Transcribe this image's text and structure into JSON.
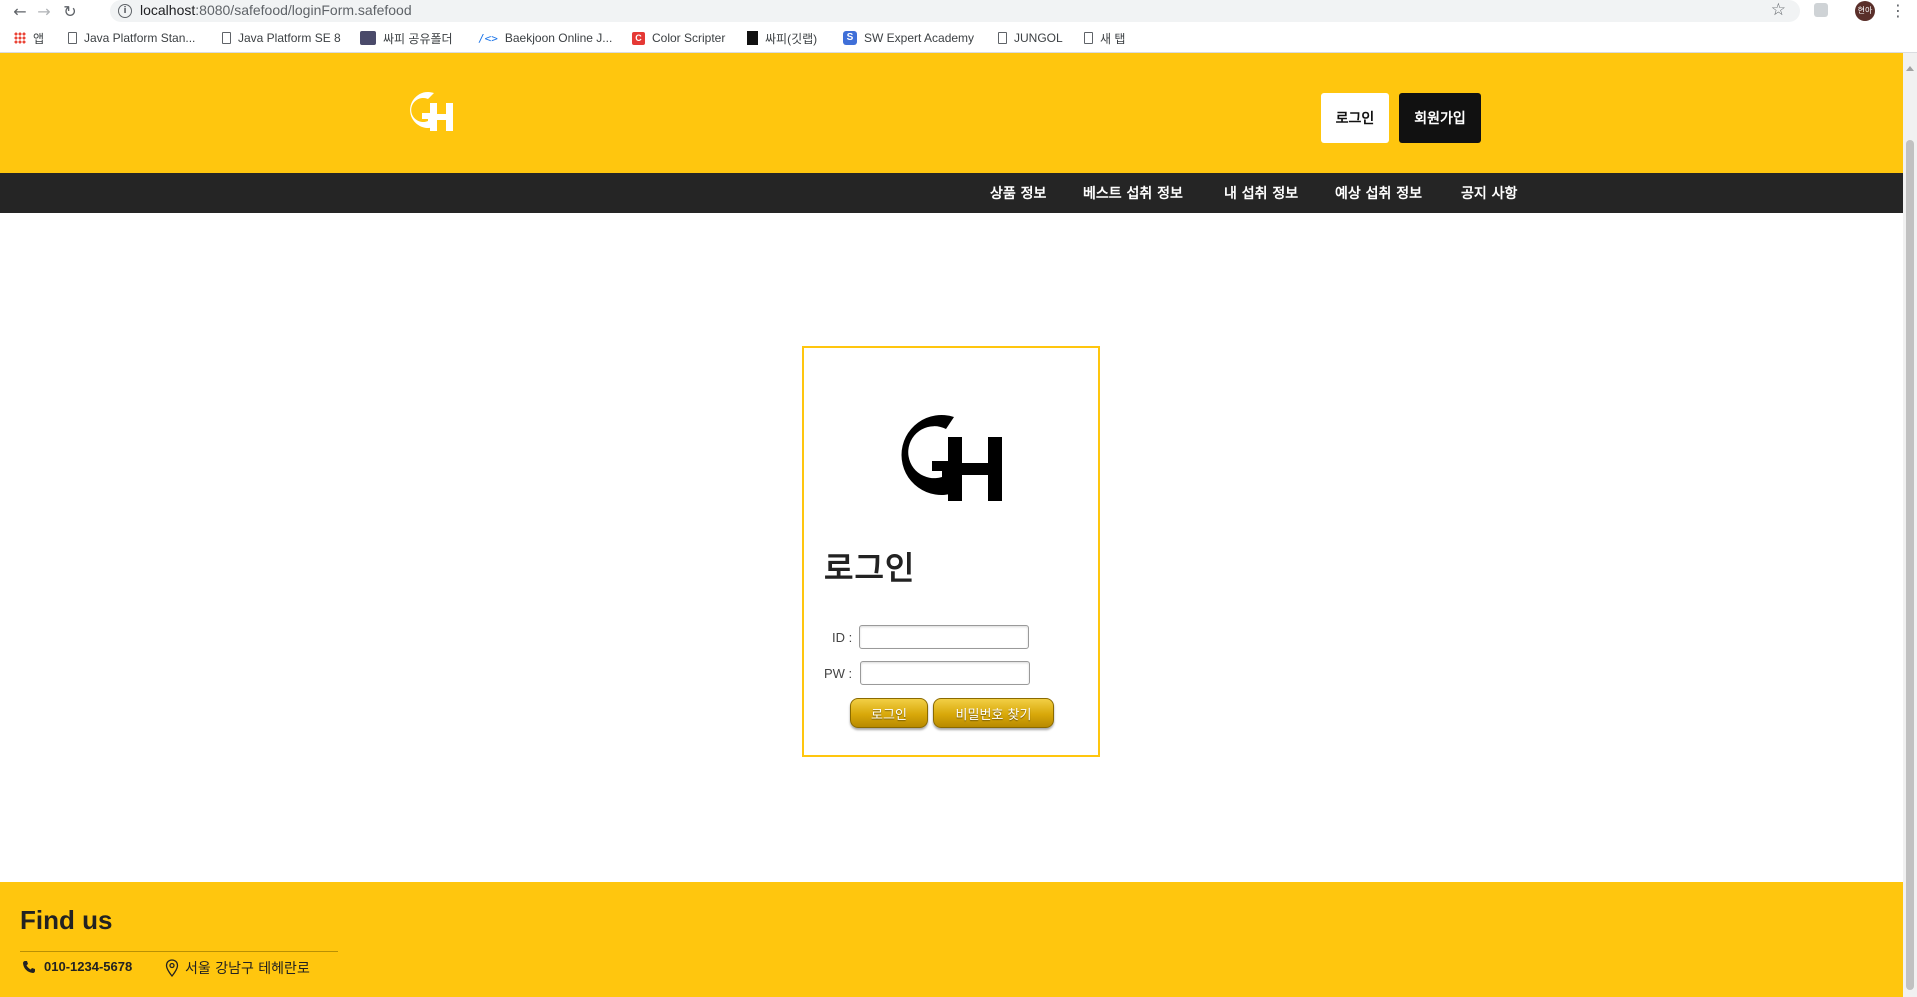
{
  "browser": {
    "url_host": "localhost",
    "url_path": ":8080/safefood/loginForm.safefood",
    "profile_label": "현아",
    "bookmarks": [
      {
        "label": "앱",
        "icon": "apps-grid-icon"
      },
      {
        "label": "Java Platform Stan...",
        "icon": "page-icon"
      },
      {
        "label": "Java Platform SE 8",
        "icon": "page-icon"
      },
      {
        "label": "싸피 공유폴더",
        "icon": "hps-icon"
      },
      {
        "label": "Baekjoon Online J...",
        "icon": "code-icon"
      },
      {
        "label": "Color Scripter",
        "icon": "color-scripter-icon"
      },
      {
        "label": "싸피(깃랩)",
        "icon": "gitlab-icon"
      },
      {
        "label": "SW Expert Academy",
        "icon": "swea-icon"
      },
      {
        "label": "JUNGOL",
        "icon": "page-icon"
      },
      {
        "label": "새 탭",
        "icon": "page-icon"
      }
    ]
  },
  "header": {
    "logo_text": "GH",
    "login_label": "로그인",
    "join_label": "회원가입"
  },
  "nav": {
    "items": [
      "상품 정보",
      "베스트 섭취 정보",
      "내 섭취 정보",
      "예상 섭취 정보",
      "공지 사항"
    ]
  },
  "login": {
    "logo_text": "GH",
    "title": "로그인",
    "id_label": "ID :",
    "pw_label": "PW :",
    "id_value": "",
    "pw_value": "",
    "submit_label": "로그인",
    "find_pw_label": "비밀번호 찾기"
  },
  "footer": {
    "title": "Find us",
    "phone": "010-1234-5678",
    "address": "서울 강남구 테헤란로"
  },
  "colors": {
    "brand_yellow": "#ffc60e",
    "nav_dark": "#252525",
    "button_black": "#111111"
  }
}
